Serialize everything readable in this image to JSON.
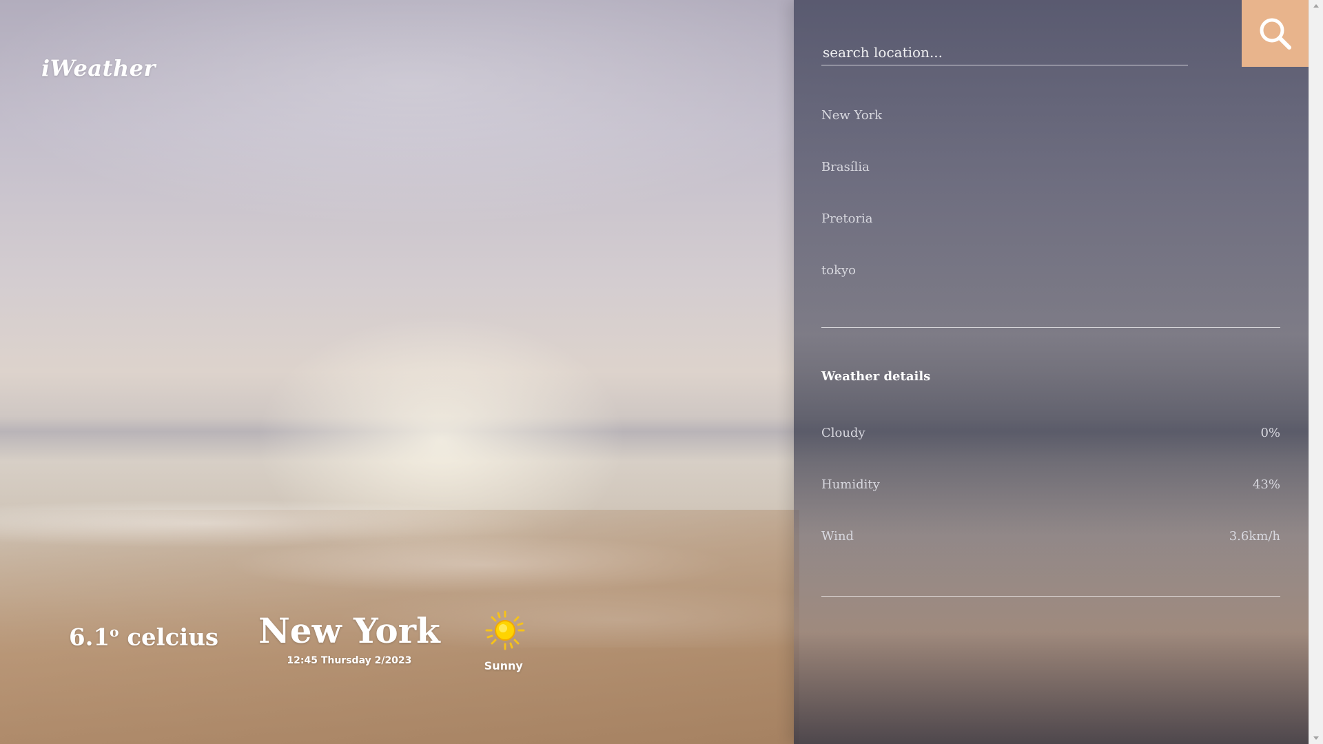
{
  "app": {
    "brand": "iWeather"
  },
  "current": {
    "temperature": "6.1",
    "degree_symbol": "o",
    "unit_text": " celcius",
    "city": "New York",
    "datetime": "12:45 Thursday 2/2023",
    "condition": "Sunny",
    "condition_icon": "sun-icon"
  },
  "search": {
    "placeholder": "search location...",
    "value": "",
    "button_icon": "search-icon"
  },
  "locations": [
    "New York",
    "Brasília",
    "Pretoria",
    "tokyo"
  ],
  "details": {
    "title": "Weather details",
    "rows": [
      {
        "label": "Cloudy",
        "value": "0%"
      },
      {
        "label": "Humidity",
        "value": "43%"
      },
      {
        "label": "Wind",
        "value": "3.6km/h"
      }
    ]
  },
  "colors": {
    "accent": "#e8b48c",
    "text": "#ffffff",
    "sun": "#ffd400"
  }
}
